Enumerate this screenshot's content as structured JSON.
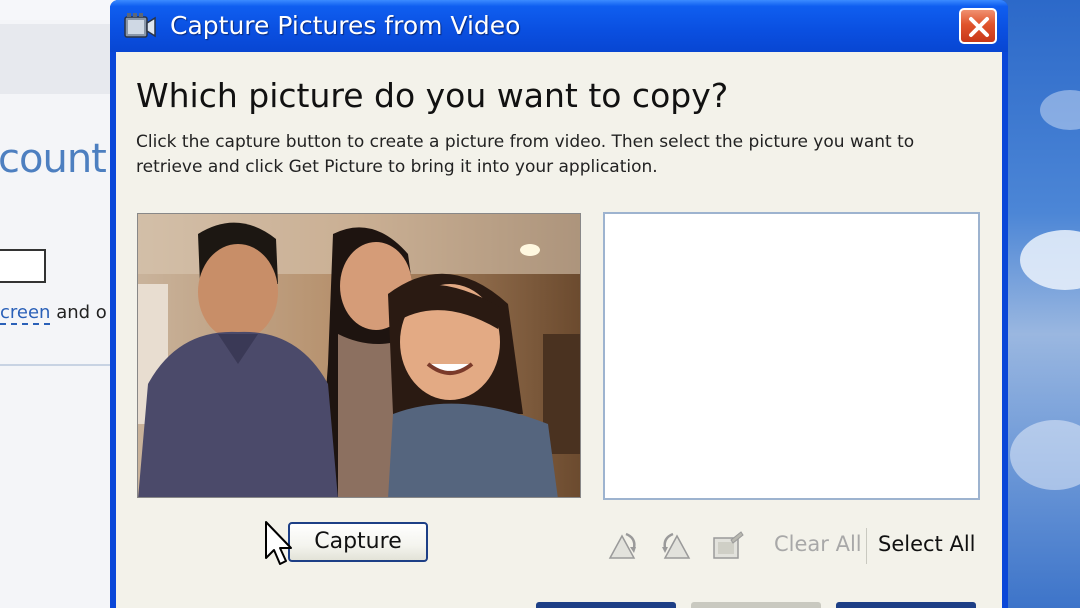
{
  "background_window": {
    "heading_fragment": "count",
    "link_fragment": "creen",
    "text_fragment": " and o"
  },
  "dialog": {
    "title": "Capture Pictures from Video",
    "question": "Which picture do you want to copy?",
    "instructions": "Click the capture button to create a picture from video. Then select the picture you want to retrieve and click Get Picture to bring it into your application.",
    "capture_label": "Capture",
    "clear_all_label": "Clear All",
    "select_all_label": "Select All"
  },
  "icons": {
    "title_icon": "camera-film-icon",
    "close": "close-icon",
    "rotate_left": "rotate-left-icon",
    "rotate_right": "rotate-right-icon",
    "properties": "picture-properties-icon",
    "cursor": "mouse-pointer-icon"
  },
  "colors": {
    "titlebar": "#0a4fe0",
    "client_bg": "#f3f2ea",
    "close_button": "#e0542c",
    "disabled_text": "#a8a8a8"
  }
}
